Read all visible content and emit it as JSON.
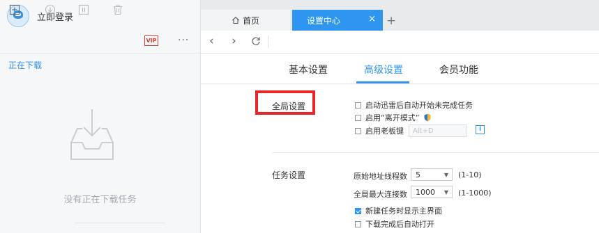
{
  "sidebar": {
    "login_label": "立即登录",
    "toolbar": {
      "vip_label": "VIP",
      "more_label": "···"
    },
    "active_tab_label": "正在下载",
    "empty_text": "没有正在下载任务"
  },
  "tabs": [
    {
      "label": "首页"
    },
    {
      "label": "设置中心",
      "close": "×"
    }
  ],
  "settings": {
    "tabs": [
      "基本设置",
      "高级设置",
      "会员功能"
    ],
    "global": {
      "title": "全局设置",
      "options": [
        {
          "label": "启动迅雷后自动开始未完成任务",
          "checked": false
        },
        {
          "label": "启用“离开模式”",
          "checked": false
        },
        {
          "label": "启用老板键",
          "checked": false
        }
      ],
      "hotkey_placeholder": "Alt+D",
      "info_label": "i"
    },
    "task": {
      "title": "任务设置",
      "rows": [
        {
          "label": "原始地址线程数",
          "value": "5",
          "range": "(1-10)"
        },
        {
          "label": "全局最大连接数",
          "value": "1000",
          "range": "(1-1000)"
        }
      ],
      "options": [
        {
          "label": "新建任务时显示主界面",
          "checked": true
        },
        {
          "label": "下载完成后自动打开",
          "checked": false
        }
      ]
    }
  },
  "colors": {
    "accent": "#2e96f0",
    "highlight_box": "#e8262a",
    "vip": "#e0403a"
  }
}
